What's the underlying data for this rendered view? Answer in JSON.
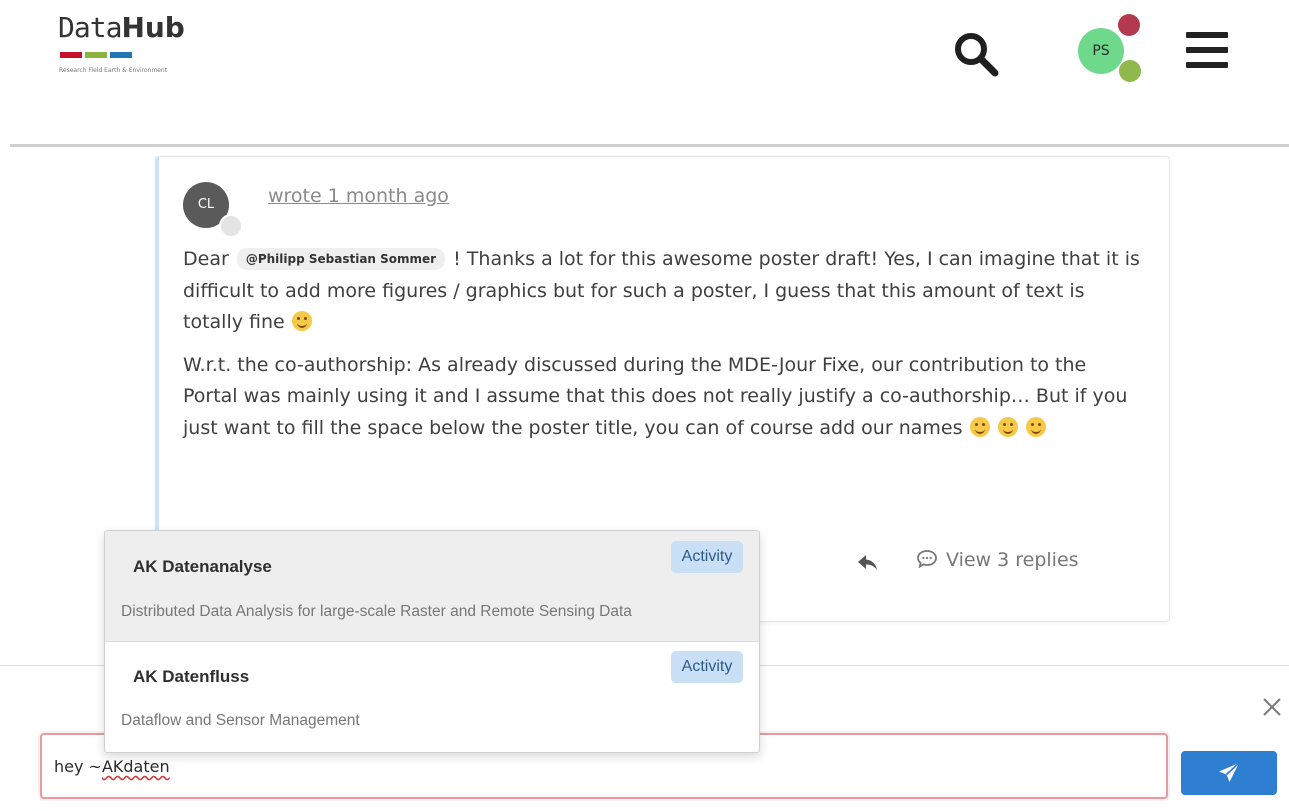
{
  "header": {
    "logo_prefix": "Data",
    "logo_suffix": "Hub",
    "logo_tagline": "Research Field Earth & Environment",
    "logo_colors": [
      "#c8102e",
      "#8db43e",
      "#1f77b4"
    ],
    "user_initials": "PS"
  },
  "comment": {
    "author_initials": "CL",
    "timestamp": "wrote 1 month ago",
    "para1_pre": "Dear",
    "mention": "@Philipp Sebastian Sommer",
    "para1_post": "! Thanks a lot for this awesome poster draft! Yes, I can imagine that it is difficult to add more figures / graphics but for such a poster, I guess that this amount of text is totally fine",
    "para2": "W.r.t. the co-authorship: As already discussed during the MDE-Jour Fixe, our contribution to the Portal was mainly using it and I assume that this does not really justify a co-authorship… But if you just want to fill the space below the poster title, you can of course add our names",
    "view_replies": "View 3 replies"
  },
  "autocomplete": {
    "items": [
      {
        "title": "AK Datenanalyse",
        "badge": "Activity",
        "description": "Distributed Data Analysis for large-scale Raster and Remote Sensing Data"
      },
      {
        "title": "AK Datenfluss",
        "badge": "Activity",
        "description": "Dataflow and Sensor Management"
      }
    ]
  },
  "composer": {
    "text_prefix": "hey ~",
    "text_misspelled": "AKdaten"
  },
  "colors": {
    "accent": "#2e7fd1",
    "avatar_ps": "#6fd98b",
    "badge_bg": "#c8dff5",
    "input_border_error": "#e89aa0"
  },
  "icons": [
    "search-icon",
    "hamburger-menu-icon",
    "reply-icon",
    "comment-bubble-icon",
    "close-icon",
    "send-icon",
    "smile-emoji-icon"
  ]
}
